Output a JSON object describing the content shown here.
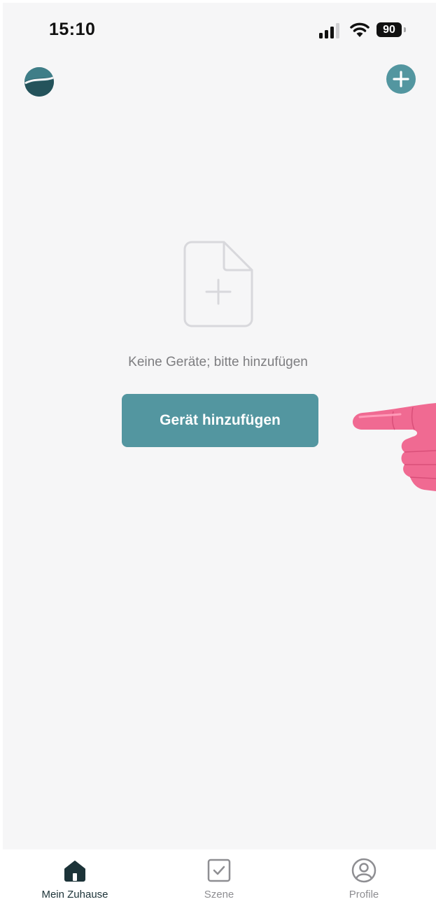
{
  "status_bar": {
    "time": "15:10",
    "battery": "90",
    "icons": [
      "signal-icon",
      "wifi-icon",
      "battery-icon"
    ]
  },
  "header": {
    "logo_icon": "app-logo-icon",
    "add_icon": "plus-circle-icon"
  },
  "empty_state": {
    "icon": "add-document-icon",
    "message": "Keine Geräte; bitte hinzufügen",
    "button_label": "Gerät hinzufügen"
  },
  "tabbar": {
    "tabs": [
      {
        "label": "Mein Zuhause",
        "icon": "home-icon",
        "active": true
      },
      {
        "label": "Szene",
        "icon": "checkbox-icon",
        "active": false
      },
      {
        "label": "Profile",
        "icon": "user-circle-icon",
        "active": false
      }
    ]
  },
  "colors": {
    "accent": "#5396a0",
    "background": "#f6f6f7",
    "active_tab": "#1c3338",
    "inactive_tab": "#8e8e92",
    "pointing_hand": "#f06a92"
  }
}
